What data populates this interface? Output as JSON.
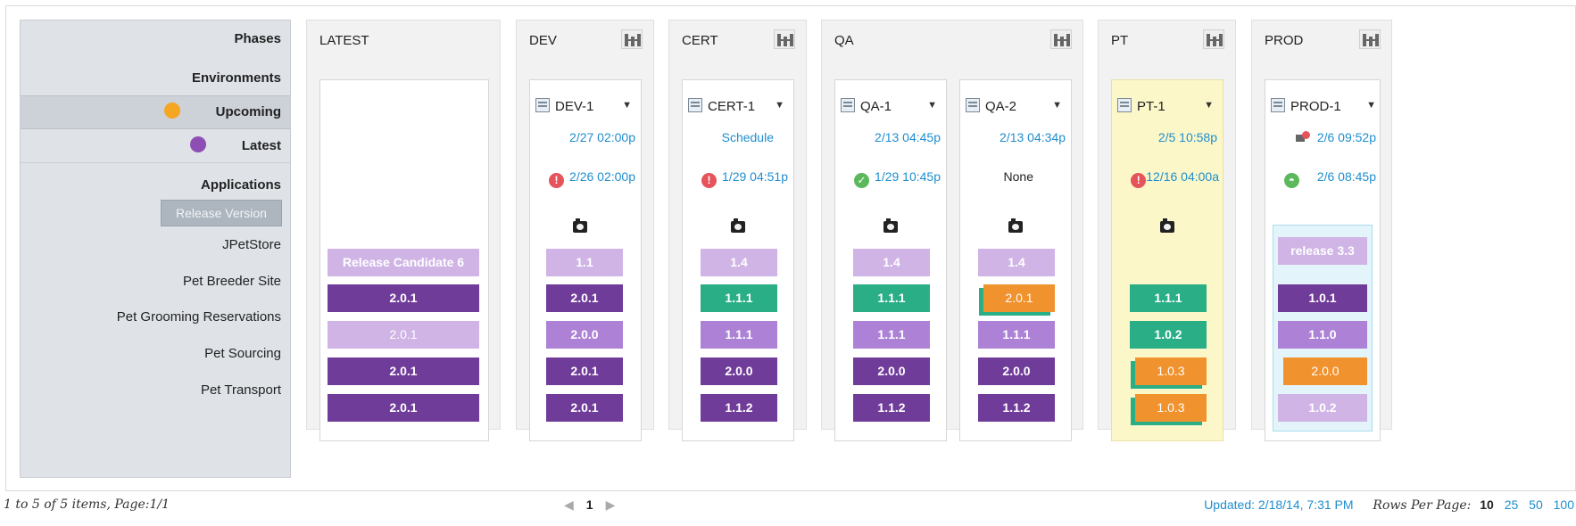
{
  "labels": {
    "phases": "Phases",
    "environments": "Environments",
    "upcoming": "Upcoming",
    "latest": "Latest",
    "applications": "Applications",
    "release_version": "Release Version",
    "apps": [
      "JPetStore",
      "Pet Breeder Site",
      "Pet Grooming Reservations",
      "Pet Sourcing",
      "Pet Transport"
    ]
  },
  "colors": {
    "upcoming_dot": "#f5a623",
    "latest_dot": "#8e4fb5",
    "link": "#1f8ecf",
    "version_dark": "#703c9a",
    "version_mid": "#ad82d6",
    "version_light": "#cfb4e5",
    "version_green": "#2aae86",
    "version_orange": "#f0922e",
    "pt_highlight": "#fbf7c9",
    "prod_highlight": "#e4f4fb"
  },
  "phases": {
    "latest": {
      "title": "LATEST",
      "release": "Release Candidate 6",
      "versions": [
        "2.0.1",
        "2.0.1",
        "2.0.1",
        "2.0.1"
      ]
    },
    "dev": {
      "title": "DEV",
      "env": "DEV-1",
      "upcoming": "2/27 02:00p",
      "latest": "2/26 02:00p",
      "latest_icon": "error-icon",
      "release": "1.1",
      "versions": [
        "2.0.1",
        "2.0.0",
        "2.0.1",
        "2.0.1"
      ]
    },
    "cert": {
      "title": "CERT",
      "env": "CERT-1",
      "upcoming": "Schedule",
      "latest": "1/29 04:51p",
      "latest_icon": "error-icon",
      "release": "1.4",
      "versions": [
        "1.1.1",
        "1.1.1",
        "2.0.0",
        "1.1.2"
      ]
    },
    "qa": {
      "title": "QA",
      "env1": "QA-1",
      "upcoming1": "2/13 04:45p",
      "latest1": "1/29 10:45p",
      "latest_icon1": "success-icon",
      "release1": "1.4",
      "versions1": [
        "1.1.1",
        "1.1.1",
        "2.0.0",
        "1.1.2"
      ],
      "env2": "QA-2",
      "upcoming2": "2/13 04:34p",
      "latest2": "None",
      "release2": "1.4",
      "versions2": [
        "2.0.1",
        "1.1.1",
        "2.0.0",
        "1.1.2"
      ]
    },
    "pt": {
      "title": "PT",
      "env": "PT-1",
      "upcoming": "2/5 10:58p",
      "latest": "12/16 04:00a",
      "latest_icon": "error-icon",
      "versions": [
        "1.1.1",
        "1.0.2",
        "1.0.3",
        "1.0.3"
      ]
    },
    "prod": {
      "title": "PROD",
      "env": "PROD-1",
      "upcoming": "2/6 09:52p",
      "latest": "2/6 08:45p",
      "latest_icon": "in-progress-icon",
      "release": "release 3.3",
      "versions": [
        "1.0.1",
        "1.1.0",
        "2.0.0",
        "1.0.2"
      ]
    }
  },
  "footer": {
    "items": "1 to 5 of 5 items, Page:1/1",
    "page": "1",
    "updated": "Updated: 2/18/14, 7:31 PM",
    "rows_label": "Rows Per Page:",
    "rows_selected": "10",
    "rows_options": [
      "25",
      "50",
      "100"
    ]
  }
}
